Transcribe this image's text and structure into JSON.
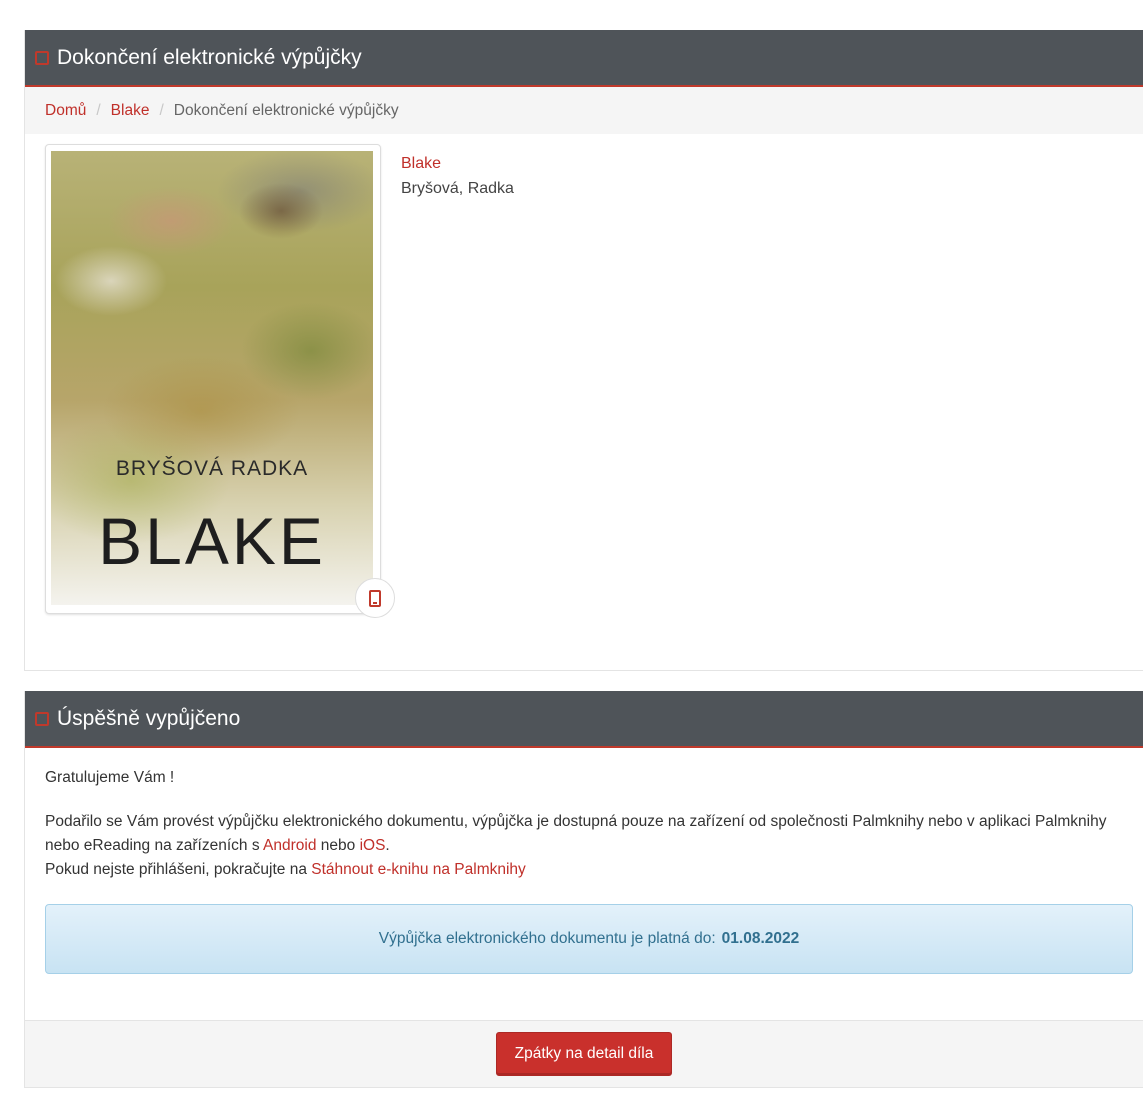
{
  "panel1": {
    "heading": "Dokončení elektronické výpůjčky",
    "breadcrumb": {
      "home": "Domů",
      "book": "Blake",
      "current": "Dokončení elektronické výpůjčky"
    },
    "book": {
      "cover_author": "BRYŠOVÁ RADKA",
      "cover_title": "BLAKE",
      "title": "Blake",
      "author": "Bryšová, Radka",
      "format_icon": "tablet-icon"
    }
  },
  "panel2": {
    "heading": "Úspěšně vypůjčeno",
    "greeting": "Gratulujeme Vám !",
    "paragraph_part1": "Podařilo se Vám provést výpůjčku elektronického dokumentu, výpůjčka je dostupná pouze na zařízení od společnosti Palmknihy nebo v aplikaci Palmknihy nebo eReading na zařízeních s ",
    "android_link": "Android",
    "paragraph_part2": " nebo ",
    "ios_link": "iOS",
    "paragraph_part3": ".",
    "login_text": "Pokud nejste přihlášeni, pokračujte na ",
    "download_link": "Stáhnout e-knihu na Palmknihy",
    "valid_label": "Výpůjčka elektronického dokumentu je platná do:",
    "valid_date": "01.08.2022",
    "back_button": "Zpátky na detail díla"
  },
  "colors": {
    "accent": "#c0392b",
    "header_bg": "#4f5459",
    "alert_text": "#31708f"
  }
}
